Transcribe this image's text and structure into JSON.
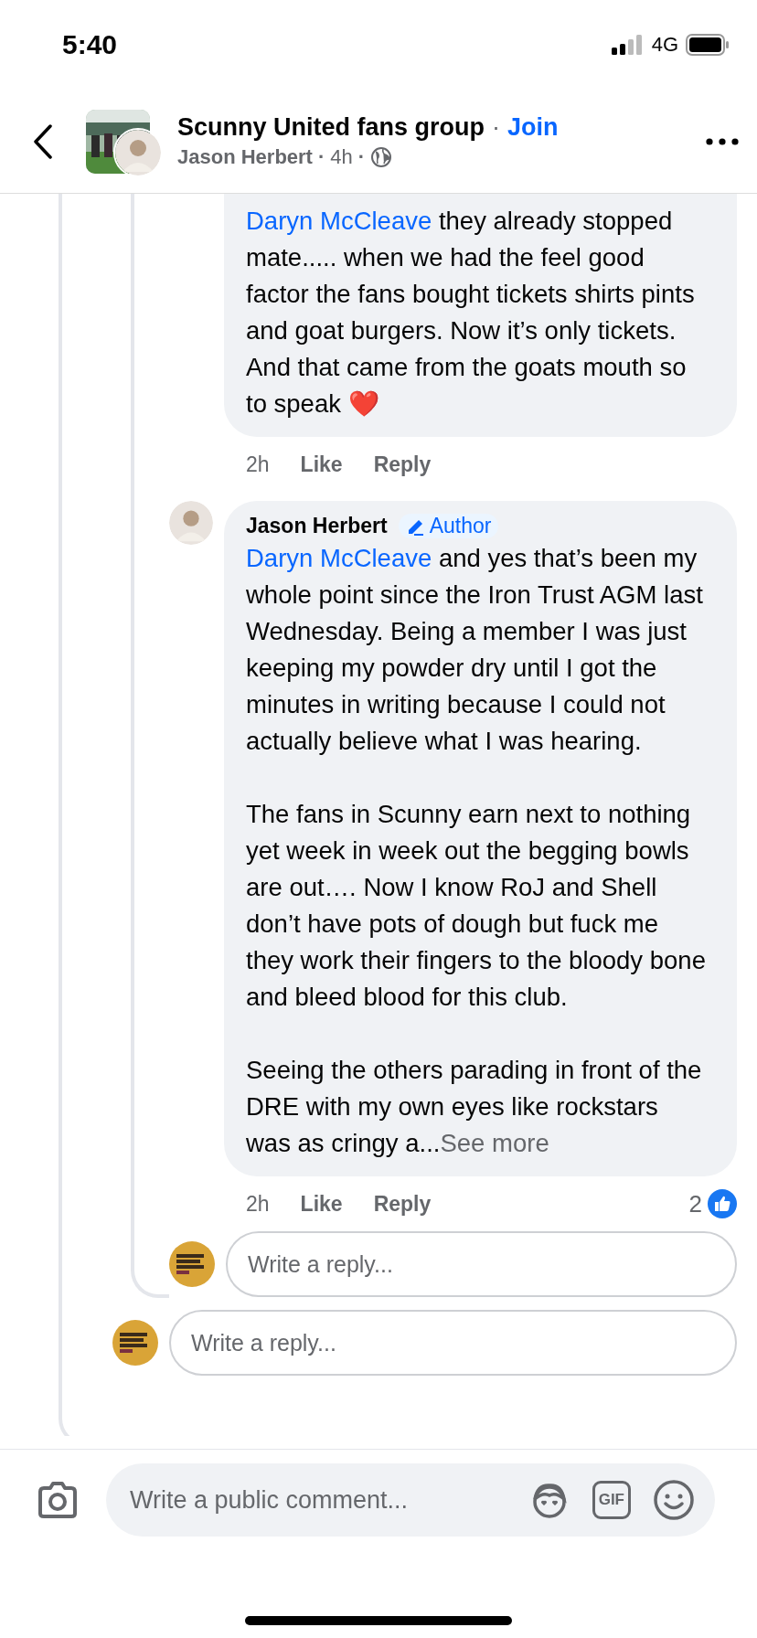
{
  "status_bar": {
    "time": "5:40",
    "network": "4G"
  },
  "header": {
    "title": "Scunny United fans group",
    "separator": "·",
    "join": "Join",
    "author": "Jason Herbert",
    "age": "4h"
  },
  "comments": [
    {
      "mention": "Daryn McCleave",
      "paragraphs": [
        "they already stopped mate..... when we had the feel good factor the fans bought tickets shirts pints and goat burgers. Now it’s only tickets. And that came from the goats mouth so to speak ❤️"
      ],
      "time": "2h",
      "like": "Like",
      "reply": "Reply"
    },
    {
      "author": "Jason Herbert",
      "badge": "Author",
      "mention": "Daryn McCleave",
      "paragraphs": [
        "and yes that’s been my whole point since the Iron Trust AGM last Wednesday. Being a member I was just keeping my powder dry until I got the minutes in writing because I could not actually believe what I was hearing.",
        "The fans in Scunny earn next to nothing yet week in week out the begging bowls are out…. Now I know RoJ and Shell don’t have pots of dough but fuck me they work their fingers to the bloody bone and bleed blood for this club.",
        "Seeing the others parading in front of the DRE with my own eyes like rockstars was as cringy a..."
      ],
      "see_more": "See more",
      "time": "2h",
      "like": "Like",
      "reply": "Reply",
      "reactions": "2"
    }
  ],
  "inner_reply": {
    "placeholder": "Write a reply..."
  },
  "outer_reply": {
    "placeholder": "Write a reply..."
  },
  "composer": {
    "placeholder": "Write a public comment...",
    "gif": "GIF"
  }
}
